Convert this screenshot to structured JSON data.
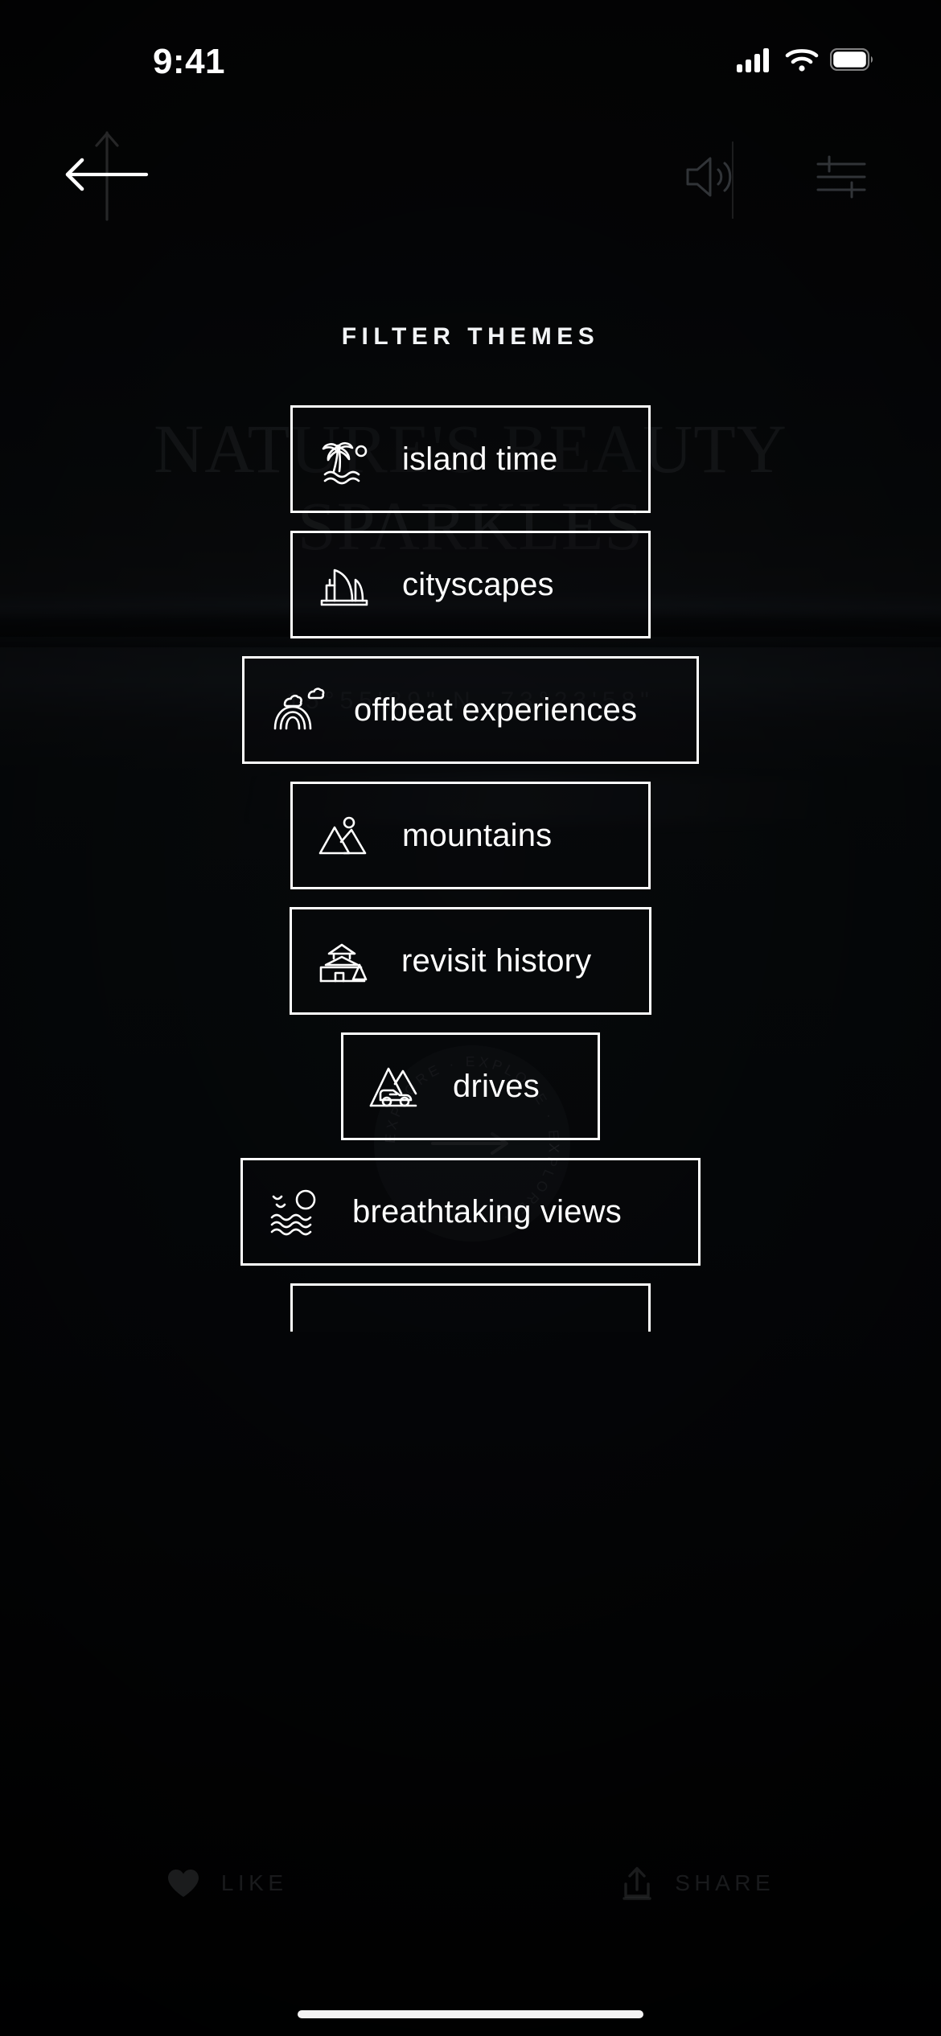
{
  "status_bar": {
    "time": "9:41",
    "cellular_icon": "cellular-signal-icon",
    "wifi_icon": "wifi-icon",
    "battery_icon": "battery-full-icon"
  },
  "top_nav": {
    "back_icon": "back-arrow-icon",
    "volume_icon": "speaker-volume-icon",
    "sliders_icon": "sliders-filter-icon"
  },
  "background": {
    "hero_title": "NATURE'S BEAUTY\nSPARKLES",
    "coordinates": "15°55'29\" N,  73°23'58\"",
    "badge_text": "EXPLORE · EXPLORE · EXPLORE · ",
    "badge_arrow_icon": "arrow-right-icon"
  },
  "sheet": {
    "title": "FILTER THEMES",
    "chips": [
      {
        "label": "island time",
        "icon": "palm-tree-icon",
        "width_class": "w-md"
      },
      {
        "label": "cityscapes",
        "icon": "skyline-icon",
        "width_class": "w-md"
      },
      {
        "label": "offbeat experiences",
        "icon": "rainbow-icon",
        "width_class": "w-lg"
      },
      {
        "label": "mountains",
        "icon": "mountains-icon",
        "width_class": "w-md"
      },
      {
        "label": "revisit history",
        "icon": "pagoda-icon",
        "width_class": "w-hist"
      },
      {
        "label": "drives",
        "icon": "car-mountain-icon",
        "width_class": "w-xs"
      },
      {
        "label": "breathtaking views",
        "icon": "sea-sun-icon",
        "width_class": "w-xl"
      },
      {
        "label": "",
        "icon": "",
        "width_class": "w-md"
      }
    ]
  },
  "action_bar": {
    "like_label": "LIKE",
    "like_icon": "heart-icon",
    "share_label": "SHARE",
    "share_icon": "share-upload-icon"
  },
  "colors": {
    "background": "#0a0c0f",
    "chip_border": "#ffffff",
    "text_primary": "#ffffff",
    "text_dim": "rgba(200,208,218,0.22)"
  },
  "home_indicator": "home-indicator"
}
